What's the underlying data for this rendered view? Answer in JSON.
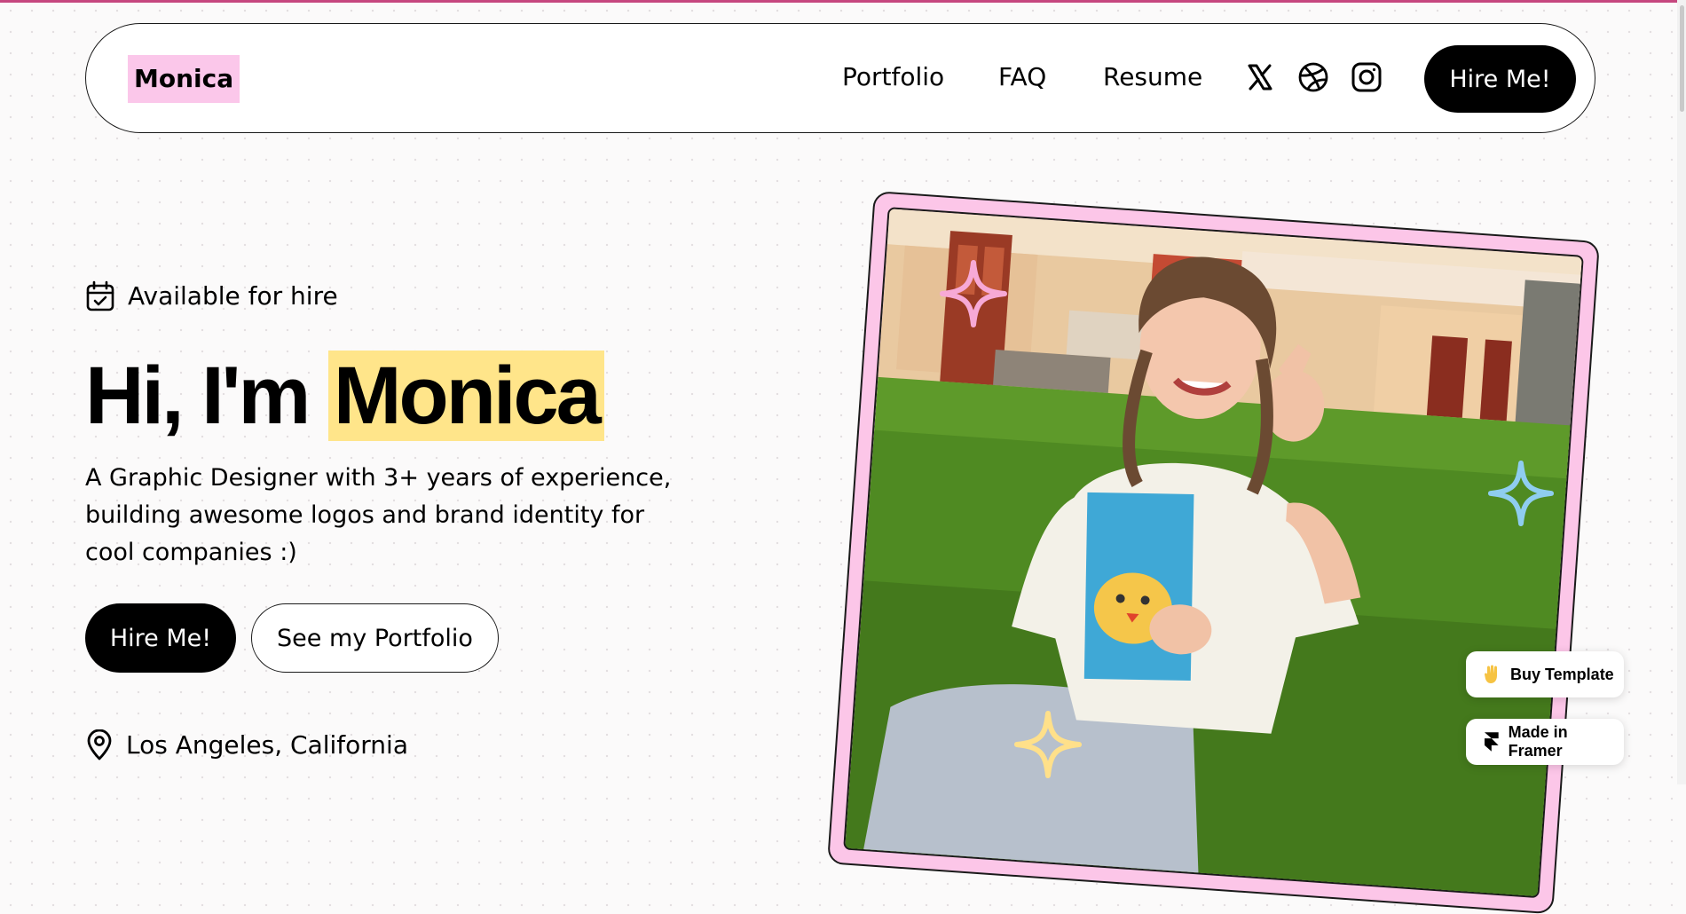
{
  "nav": {
    "logo": "Monica",
    "links": [
      "Portfolio",
      "FAQ",
      "Resume"
    ],
    "icons": [
      "x-twitter-icon",
      "dribbble-icon",
      "instagram-icon"
    ],
    "hire_label": "Hire Me!"
  },
  "hero": {
    "availability": "Available for hire",
    "headline_prefix": "Hi, I'm ",
    "headline_name": "Monica",
    "description": "A Graphic Designer with 3+ years of experience, building awesome logos and brand identity for cool companies :)",
    "hire_label": "Hire Me!",
    "portfolio_label": "See my Portfolio",
    "location": "Los Angeles, California"
  },
  "badges": {
    "buy_template": "Buy Template",
    "made_in_framer": "Made in Framer"
  },
  "colors": {
    "logo_highlight": "#fbc7ea",
    "name_highlight": "#ffe58a",
    "frame_pink": "#fcc6e8",
    "sparkle_pink": "#f7a9d6",
    "sparkle_blue": "#8fcdf0",
    "sparkle_yellow": "#ffe08a",
    "accent_line": "#c6477f"
  }
}
